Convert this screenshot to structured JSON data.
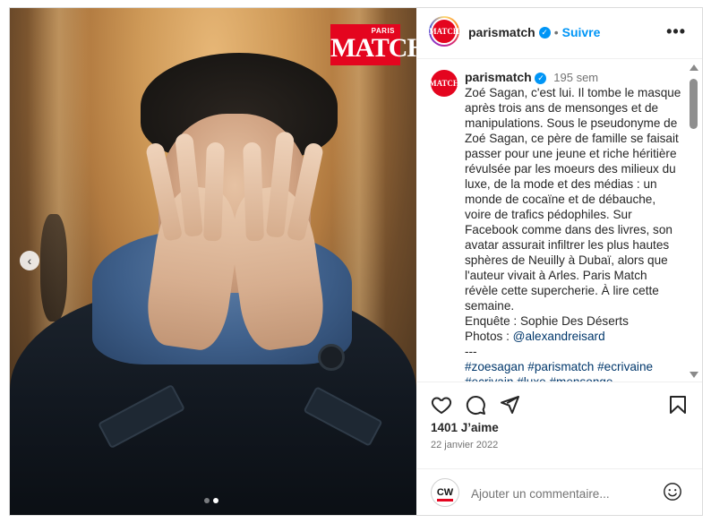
{
  "post": {
    "logo": {
      "small": "PARIS",
      "big": "MATCH"
    },
    "carousel": {
      "count": 2,
      "active": 1
    }
  },
  "header": {
    "username": "parismatch",
    "follow_label": "Suivre",
    "more_label": "•••"
  },
  "caption": {
    "username": "parismatch",
    "age": "195 sem",
    "text": "Zoé Sagan, c'est lui. Il tombe le masque après trois ans de mensonges et de manipulations. Sous le pseudonyme de Zoé Sagan, ce père de famille se faisait passer pour une jeune et riche héritière révulsée par les moeurs des milieux du luxe, de la mode et des médias : un monde de cocaïne et de débauche, voire de trafics pédophiles. Sur Facebook comme dans des livres, son avatar assurait infiltrer les plus hautes sphères de Neuilly à Dubaï, alors que l'auteur vivait à Arles. Paris Match révèle cette supercherie. À lire cette semaine.",
    "credit_enquete": "Enquête : Sophie Des Déserts",
    "credit_photos_label": "Photos : ",
    "credit_photos_mention": "@alexandreisard",
    "separator": "---",
    "tags_line1": "#zoesagan #parismatch #ecrivaine",
    "tags_line2": "#ecrivain #luxe #mensonge"
  },
  "engagement": {
    "likes": "1401 J’aime",
    "date": "22 janvier 2022"
  },
  "comment_box": {
    "avatar_text": "CW",
    "placeholder": "Ajouter un commentaire..."
  },
  "icons": [
    "chevron-left-icon",
    "heart-icon",
    "comment-icon",
    "share-icon",
    "bookmark-icon",
    "emoji-icon",
    "verified-icon",
    "more-icon"
  ]
}
